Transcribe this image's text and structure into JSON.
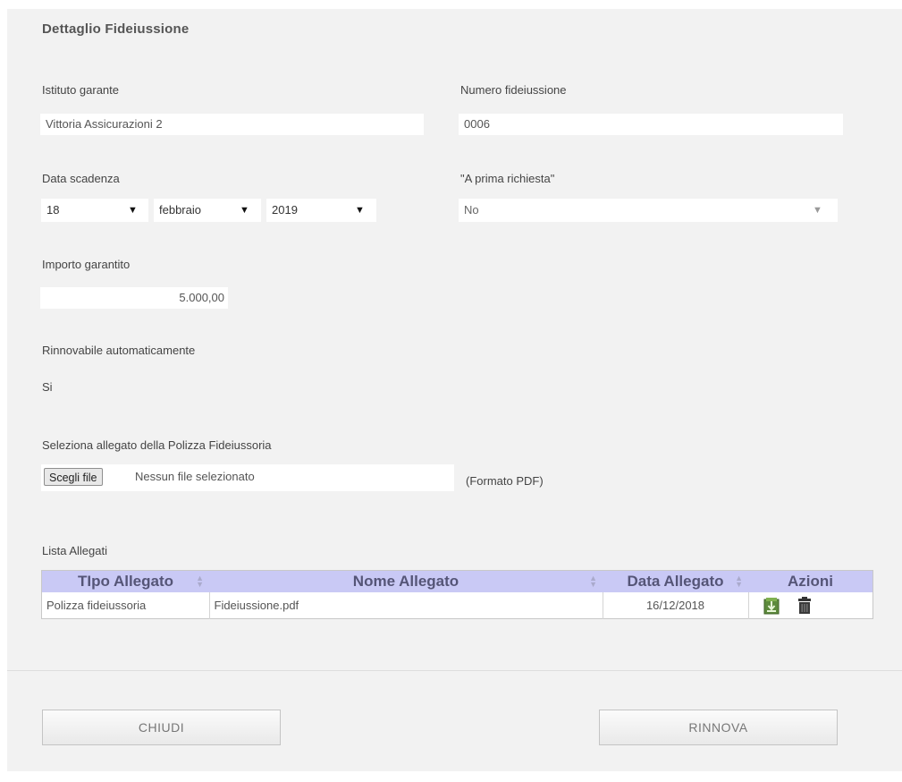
{
  "form": {
    "title": "Dettaglio Fideiussione",
    "istituto_label": "Istituto garante",
    "istituto_value": "Vittoria Assicurazioni 2",
    "numero_label": "Numero fideiussione",
    "numero_value": "0006",
    "scadenza_label": "Data scadenza",
    "scadenza_day": "18",
    "scadenza_month": "febbraio",
    "scadenza_year": "2019",
    "prima_richiesta_label": "\"A prima richiesta\"",
    "prima_richiesta_value": "No",
    "importo_label": "Importo garantito",
    "importo_value": "5.000,00",
    "rinnovabile_label": "Rinnovabile automaticamente",
    "rinnovabile_value": "Si",
    "allegato_label": "Seleziona allegato della Polizza Fideiussoria",
    "file_button": "Scegli file",
    "file_status": "Nessun file selezionato",
    "file_hint": "(Formato PDF)"
  },
  "attachments": {
    "title": "Lista Allegati",
    "columns": [
      "TIpo Allegato",
      "Nome Allegato",
      "Data Allegato",
      "Azioni"
    ],
    "rows": [
      {
        "tipo": "Polizza fideiussoria",
        "nome": "Fideiussione.pdf",
        "data": "16/12/2018"
      }
    ],
    "icons": [
      "download-icon",
      "trash-icon"
    ]
  },
  "footer": {
    "close_label": "CHIUDI",
    "renew_label": "RINNOVA"
  },
  "colors": {
    "panel_bg": "#f2f2f2",
    "table_header_bg": "#c9c9f5"
  }
}
